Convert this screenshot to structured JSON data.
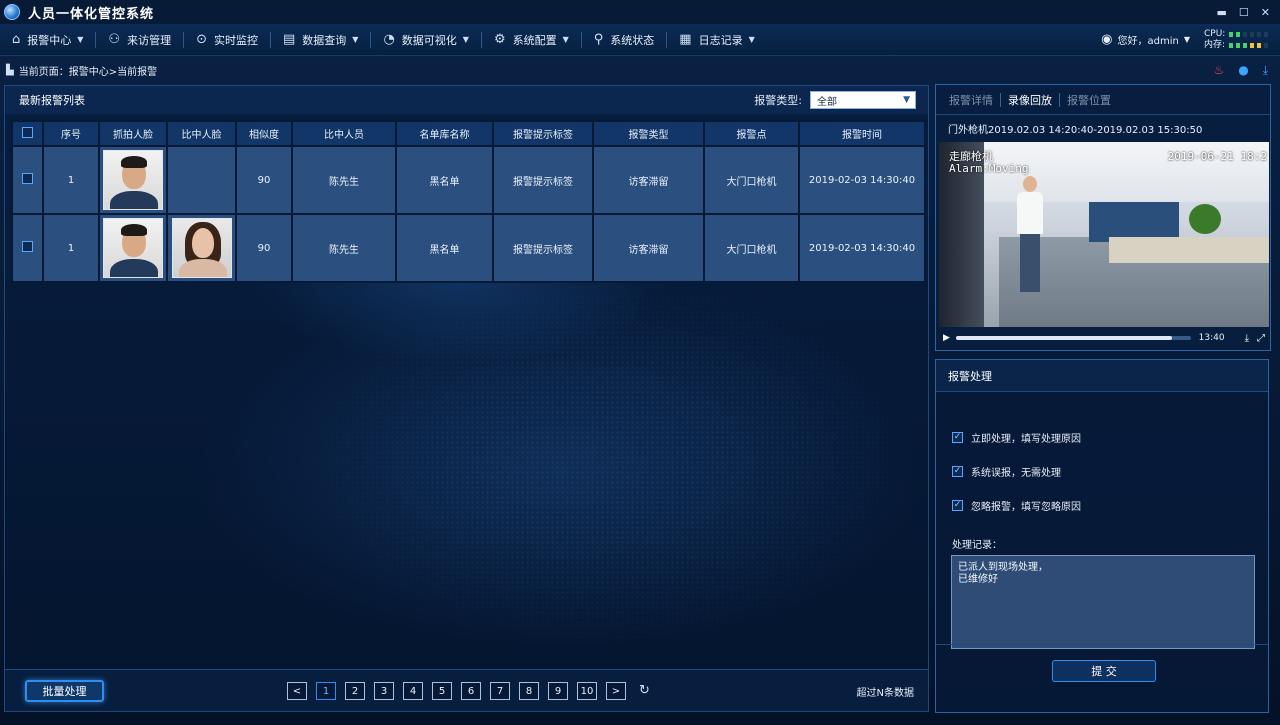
{
  "app": {
    "title": "人员一体化管控系统",
    "window_controls": [
      "▬",
      "☐",
      "✕"
    ]
  },
  "nav": {
    "items": [
      {
        "label": "报警中心",
        "icon": "alarm-center-icon",
        "dropdown": true
      },
      {
        "label": "来访管理",
        "icon": "visitor-icon",
        "dropdown": false
      },
      {
        "label": "实时监控",
        "icon": "location-pin-icon",
        "dropdown": false
      },
      {
        "label": "数据查询",
        "icon": "document-search-icon",
        "dropdown": true
      },
      {
        "label": "数据可视化",
        "icon": "pie-chart-icon",
        "dropdown": true
      },
      {
        "label": "系统配置",
        "icon": "settings-icon",
        "dropdown": true
      },
      {
        "label": "系统状态",
        "icon": "route-icon",
        "dropdown": false
      },
      {
        "label": "日志记录",
        "icon": "calendar-icon",
        "dropdown": true
      }
    ],
    "user": {
      "greeting": "您好，admin"
    },
    "meters": {
      "cpu_label": "CPU:",
      "mem_label": "内存:"
    }
  },
  "breadcrumb": {
    "text": "当前页面：报警中心>当前报警"
  },
  "alarm_list": {
    "title": "最新报警列表",
    "filter_label": "报警类型:",
    "filter_value": "全部",
    "columns": [
      "",
      "序号",
      "抓拍人脸",
      "比中人脸",
      "相似度",
      "比中人员",
      "名单库名称",
      "报警提示标签",
      "报警类型",
      "报警点",
      "报警时间"
    ],
    "rows": [
      {
        "index": "1",
        "similarity": "90",
        "person": "陈先生",
        "list": "黑名单",
        "tag": "报警提示标签",
        "type": "访客滞留",
        "point": "大门口枪机",
        "time": "2019-02-03 14:30:40",
        "has_match_face": false
      },
      {
        "index": "1",
        "similarity": "90",
        "person": "陈先生",
        "list": "黑名单",
        "tag": "报警提示标签",
        "type": "访客滞留",
        "point": "大门口枪机",
        "time": "2019-02-03 14:30:40",
        "has_match_face": true
      }
    ]
  },
  "pager": {
    "batch_label": "批量处理",
    "prev": "<",
    "next": ">",
    "pages": [
      "1",
      "2",
      "3",
      "4",
      "5",
      "6",
      "7",
      "8",
      "9",
      "10"
    ],
    "active_page": "1",
    "total": "超过N条数据"
  },
  "video": {
    "tabs": [
      "报警详情",
      "录像回放",
      "报警位置"
    ],
    "active_tab": "录像回放",
    "caption": "门外枪机2019.02.03 14:20:40-2019.02.03 15:30:50",
    "osd_cam": "走廊枪机",
    "osd_alarm": "Alarm:Moving",
    "osd_time": "2019-06-21 18:2",
    "duration": "13:40",
    "progress": 0.92
  },
  "handling": {
    "title": "报警处理",
    "options": [
      "立即处理，填写处理原因",
      "系统误报，无需处理",
      "忽略报警，填写忽略原因"
    ],
    "record_label": "处理记录：",
    "record_text": "已派人到现场处理，\n已维修好",
    "submit": "提 交"
  },
  "colors": {
    "accent": "#2f8ef0",
    "alarm": "#ff4b4b",
    "ok_meter": "#47d16b"
  }
}
